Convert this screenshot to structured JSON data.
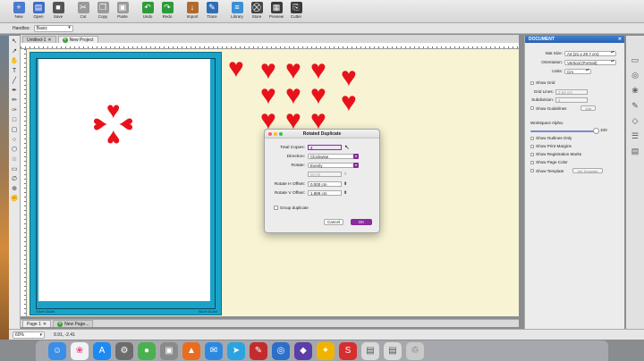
{
  "toolbar": {
    "buttons": [
      {
        "label": "New",
        "icon": "new-doc-icon",
        "color": "#4a7bd0",
        "glyph": "+"
      },
      {
        "label": "Open",
        "icon": "folder-icon",
        "color": "#3f6fc4",
        "glyph": "▤"
      },
      {
        "label": "Save",
        "icon": "save-icon",
        "color": "#555555",
        "glyph": "■"
      },
      {
        "label": "Cut",
        "icon": "scissors-icon",
        "color": "#9a9a9a",
        "glyph": "✂"
      },
      {
        "label": "Copy",
        "icon": "copy-icon",
        "color": "#9a9a9a",
        "glyph": "❐"
      },
      {
        "label": "Paste",
        "icon": "paste-icon",
        "color": "#9a9a9a",
        "glyph": "▣"
      },
      {
        "label": "Undo",
        "icon": "undo-icon",
        "color": "#2e9b3b",
        "glyph": "↶"
      },
      {
        "label": "Redo",
        "icon": "redo-icon",
        "color": "#2e9b3b",
        "glyph": "↷"
      },
      {
        "label": "Import",
        "icon": "import-icon",
        "color": "#b06a2c",
        "glyph": "↓"
      },
      {
        "label": "Trace",
        "icon": "trace-icon",
        "color": "#2f6db5",
        "glyph": "✎"
      },
      {
        "label": "Library",
        "icon": "library-icon",
        "color": "#3c8fd6",
        "glyph": "≡"
      },
      {
        "label": "Store",
        "icon": "cart-icon",
        "color": "#444444",
        "glyph": "⛒"
      },
      {
        "label": "Preview",
        "icon": "preview-icon",
        "color": "#3a3a3a",
        "glyph": "▦"
      },
      {
        "label": "Cutter",
        "icon": "cutter-icon",
        "color": "#3a3a3a",
        "glyph": "⎘"
      }
    ]
  },
  "handles": {
    "label": "Handles:",
    "value": "Basic"
  },
  "tabs": {
    "doc1": "Untitled-1",
    "doc2": "New Project"
  },
  "page_tabs": {
    "page1": "Page 1",
    "add": "New Page..."
  },
  "mat": {
    "label_left": "Silver Bullet",
    "label_right": "Silver Bullet"
  },
  "dialog": {
    "title": "Rotated Duplicate",
    "total_copies_label": "Total Copies:",
    "total_copies_value": "4",
    "direction_label": "Direction:",
    "direction_value": "Clockwise",
    "rotate_label": "Rotate:",
    "rotate_value": "Evenly",
    "angle_value": "90.00",
    "h_offset_label": "Rotate H Offset:",
    "h_offset_value": "0.000 cm",
    "v_offset_label": "Rotate V Offset:",
    "v_offset_value": "1.889 cm",
    "group_label": "Group duplicate",
    "cancel": "Cancel",
    "ok": "OK",
    "accent": "#8a2b9e"
  },
  "inspector": {
    "title": "DOCUMENT",
    "mat_size_label": "Mat Size:",
    "mat_size_value": "A4 (21 x 29.7 cm)",
    "orientation_label": "Orientation:",
    "orientation_value": "Vertical (Portrait)",
    "units_label": "Units:",
    "units_value": "Cm",
    "show_grid": "Show Grid",
    "grid_lines_label": "Grid Lines:",
    "grid_lines_value": "2.54 cm",
    "subdivision_label": "Subdivision:",
    "subdivision_value": "4",
    "show_guidelines": "Show Guidelines",
    "edit": "Edit",
    "workspace_alpha_label": "Workspace Alpha:",
    "workspace_alpha_value": "100",
    "workspace_alpha_fraction": 1.0,
    "show_outlines": "Show Outlines Only",
    "show_print_margins": "Show Print Margins",
    "show_registration": "Show Registration Marks",
    "show_page_color": "Show Page Color",
    "show_template": "Show Template",
    "set_template": "Set Template"
  },
  "status": {
    "zoom": "60%",
    "coords": "9.91, -2.41"
  },
  "colors": {
    "heart": "#e8121b",
    "mat": "#1aa3c8",
    "workspace": "#f7f3d3"
  }
}
